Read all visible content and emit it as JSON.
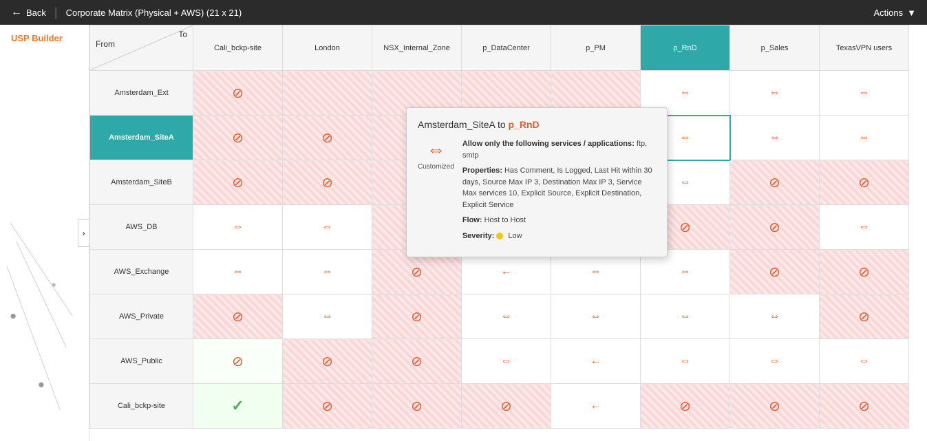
{
  "topbar": {
    "back_label": "Back",
    "title": "Corporate Matrix (Physical + AWS)  (21 x 21)",
    "actions_label": "Actions"
  },
  "sidebar": {
    "label": "USP Builder"
  },
  "matrix": {
    "corner": {
      "to": "To",
      "from": "From"
    },
    "col_headers": [
      "Cali_bckp-site",
      "London",
      "NSX_Internal_Zone",
      "p_DataCenter",
      "p_PM",
      "p_RnD",
      "p_Sales",
      "TexasVPN users"
    ],
    "row_headers": [
      "Amsterdam_Ext",
      "Amsterdam_SiteA",
      "Amsterdam_SiteB",
      "AWS_DB",
      "AWS_Exchange",
      "AWS_Private",
      "AWS_Public",
      "Cali_bckp-site"
    ],
    "active_col": 5,
    "active_row": 1
  },
  "tooltip": {
    "source": "Amsterdam_SiteA",
    "dest": "p_RnD",
    "connector": "to",
    "services_label": "Allow only the following services / applications:",
    "services_value": "ftp, smtp",
    "properties_label": "Properties:",
    "properties_value": "Has Comment, Is Logged, Last Hit within 30 days, Source Max IP 3, Destination Max IP 3, Service Max services 10, Explicit Source, Explicit Destination, Explicit Service",
    "flow_label": "Flow:",
    "flow_value": "Host to Host",
    "severity_label": "Severity:",
    "severity_value": "Low",
    "icon_label": "Customized"
  },
  "cells": {
    "block_icon": "⊘",
    "arrows_icon": "⇔",
    "arrows_right": "→",
    "arrows_left": "←",
    "check_icon": "✓"
  }
}
